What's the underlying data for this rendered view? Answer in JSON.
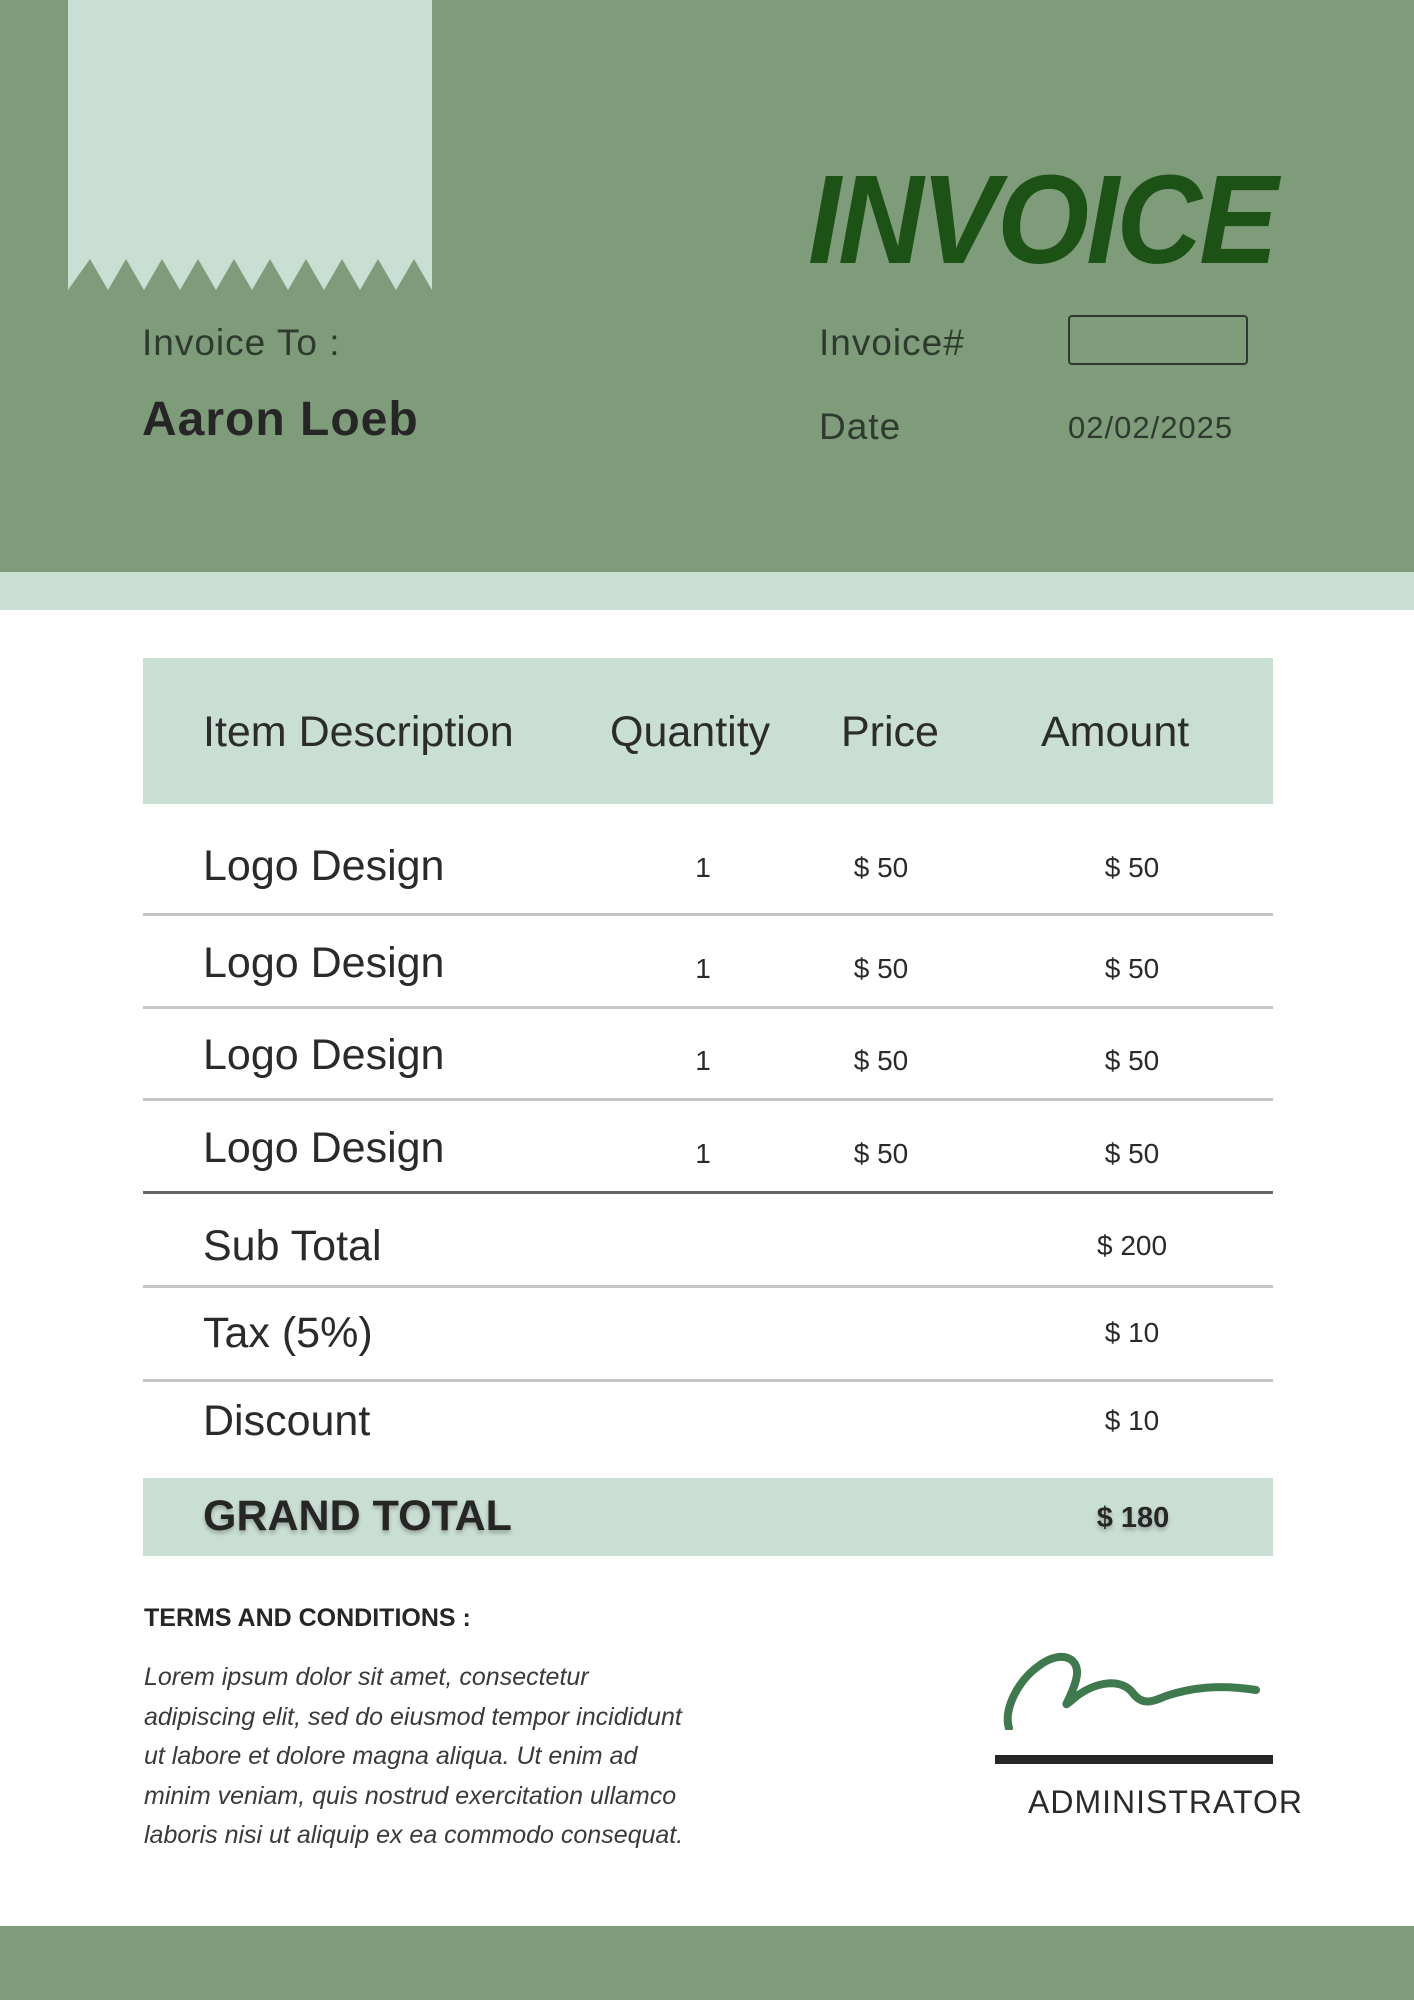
{
  "header": {
    "title": "INVOICE",
    "invoice_to_label": "Invoice To :",
    "client_name": "Aaron Loeb",
    "invoice_number_label": "Invoice#",
    "invoice_number_value": "",
    "date_label": "Date",
    "date_value": "02/02/2025"
  },
  "table": {
    "columns": [
      "Item Description",
      "Quantity",
      "Price",
      "Amount"
    ],
    "rows": [
      {
        "description": "Logo Design",
        "quantity": "1",
        "price": "$ 50",
        "amount": "$ 50"
      },
      {
        "description": "Logo Design",
        "quantity": "1",
        "price": "$ 50",
        "amount": "$ 50"
      },
      {
        "description": "Logo Design",
        "quantity": "1",
        "price": "$ 50",
        "amount": "$ 50"
      },
      {
        "description": "Logo Design",
        "quantity": "1",
        "price": "$ 50",
        "amount": "$ 50"
      }
    ]
  },
  "totals": {
    "subtotal_label": "Sub Total",
    "subtotal_value": "$ 200",
    "tax_label": "Tax (5%)",
    "tax_value": "$ 10",
    "discount_label": "Discount",
    "discount_value": "$ 10",
    "grand_total_label": "GRAND TOTAL",
    "grand_total_value": "$ 180"
  },
  "terms": {
    "title": "TERMS  AND CONDITIONS :",
    "body": "Lorem ipsum dolor sit amet, consectetur adipiscing elit, sed do eiusmod tempor incididunt ut labore et dolore magna aliqua. Ut enim ad minim veniam, quis nostrud exercitation ullamco laboris nisi ut aliquip ex ea commodo consequat."
  },
  "signature": {
    "name": "ADMINISTRATOR"
  },
  "colors": {
    "header_bg": "#7e9c7a",
    "accent_light": "#cadfd4",
    "title": "#1c5215",
    "signature_ink": "#3f7a4e"
  }
}
